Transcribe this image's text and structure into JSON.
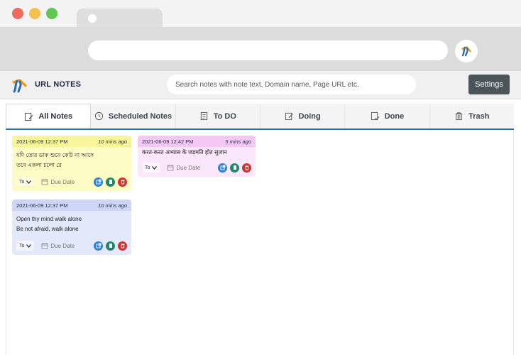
{
  "app": {
    "title": "URL NOTES",
    "search_placeholder": "Search notes with note text, Domain name, Page URL etc.",
    "settings_label": "Settings",
    "accent_color": "#2b6cb0"
  },
  "tabs": [
    {
      "label": "All Notes",
      "icon": "edit-note-icon",
      "active": true
    },
    {
      "label": "Scheduled Notes",
      "icon": "clock-icon",
      "active": false
    },
    {
      "label": "To DO",
      "icon": "document-icon",
      "active": false
    },
    {
      "label": "Doing",
      "icon": "pencil-doc-icon",
      "active": false
    },
    {
      "label": "Done",
      "icon": "done-doc-icon",
      "active": false
    },
    {
      "label": "Trash",
      "icon": "trash-icon",
      "active": false
    }
  ],
  "notes": [
    {
      "timestamp": "2021-06-09 12:37 PM",
      "ago": "10 mins ago",
      "lines": [
        "যদি তোর ডাক শুনে কেউ না আসে",
        "তবে একলা চলো রে"
      ],
      "status": "To",
      "due_label": "Due Date",
      "color": "#fdfbc4"
    },
    {
      "timestamp": "2021-06-09 12:42 PM",
      "ago": "5 mins ago",
      "lines": [
        "करत-करत अभ्यास के जड़मति होत सुजान"
      ],
      "status": "To",
      "due_label": "Due Date",
      "color": "#fbe7fb"
    },
    {
      "timestamp": "2021-06-09 12:37 PM",
      "ago": "10 mins ago",
      "lines": [
        "Open thy mind walk alone",
        "Be not afraid, walk alone"
      ],
      "status": "To",
      "due_label": "Due Date",
      "color": "#e3e8fb"
    }
  ]
}
